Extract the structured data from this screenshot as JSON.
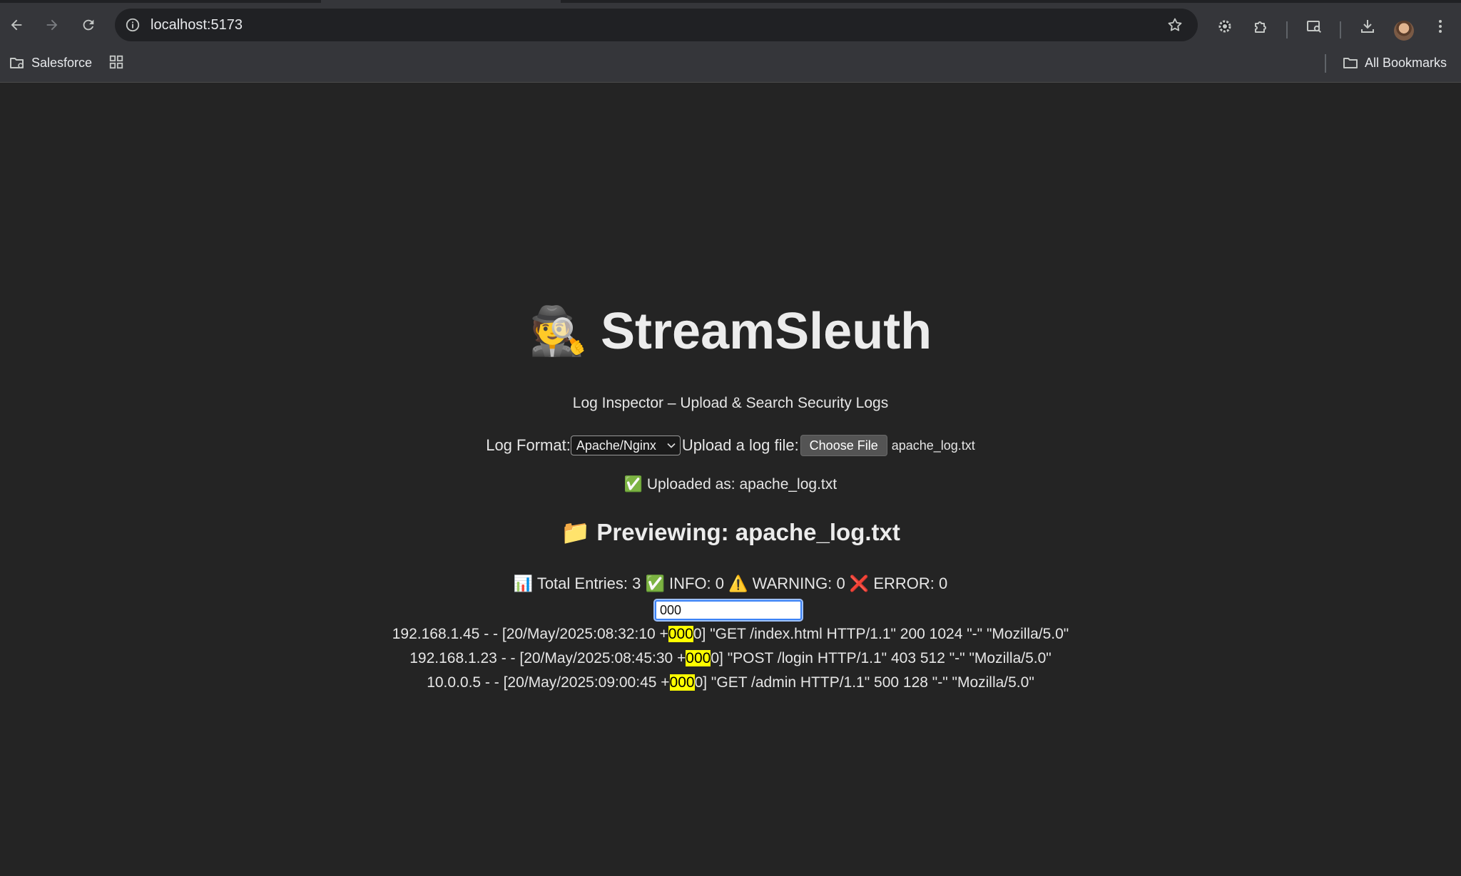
{
  "browser": {
    "url": "localhost:5173",
    "bookmarks": [
      {
        "label": "Salesforce"
      }
    ],
    "all_bookmarks_label": "All Bookmarks"
  },
  "app": {
    "title": "StreamSleuth",
    "title_emoji": "🕵️",
    "subtitle": "Log Inspector – Upload & Search Security Logs",
    "log_format_label": "Log Format:",
    "log_format_value": "Apache/Nginx",
    "upload_label": "Upload a log file:",
    "choose_file_label": "Choose File",
    "chosen_file": "apache_log.txt",
    "uploaded_text": "✅ Uploaded as: apache_log.txt",
    "preview_title": "📁 Previewing: apache_log.txt",
    "stats": {
      "total_label": "📊 Total Entries:",
      "total": "3",
      "info_label": "✅ INFO:",
      "info": "0",
      "warning_label": "⚠️ WARNING:",
      "warning": "0",
      "error_label": "❌ ERROR:",
      "error": "0"
    },
    "search_value": "000",
    "highlight_color": "#ffff00",
    "log_lines": [
      {
        "before": "192.168.1.45 - - [20/May/2025:08:32:10 +",
        "match": "000",
        "after": "0] \"GET /index.html HTTP/1.1\" 200 1024 \"-\" \"Mozilla/5.0\""
      },
      {
        "before": "192.168.1.23 - - [20/May/2025:08:45:30 +",
        "match": "000",
        "after": "0] \"POST /login HTTP/1.1\" 403 512 \"-\" \"Mozilla/5.0\""
      },
      {
        "before": "10.0.0.5 - - [20/May/2025:09:00:45 +",
        "match": "000",
        "after": "0] \"GET /admin HTTP/1.1\" 500 128 \"-\" \"Mozilla/5.0\""
      }
    ]
  }
}
